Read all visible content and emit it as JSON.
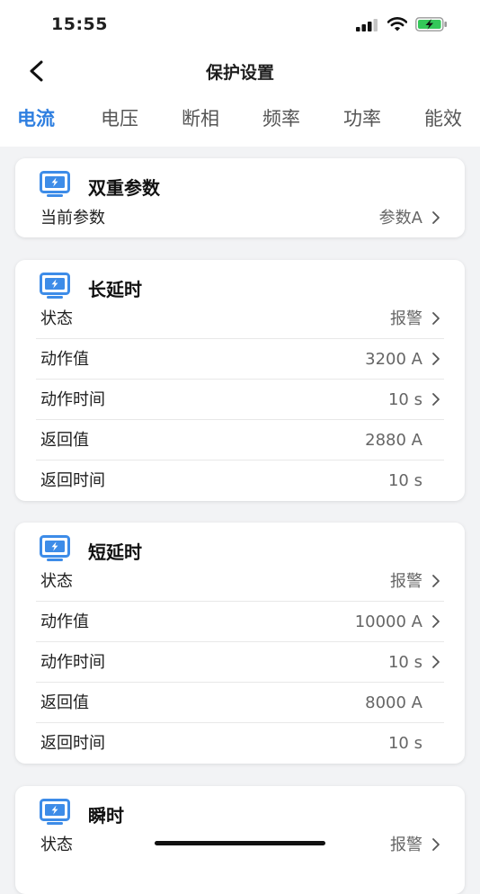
{
  "status_bar": {
    "time": "15:55",
    "icons": [
      "signal-icon",
      "wifi-icon",
      "battery-charging-icon"
    ]
  },
  "nav": {
    "title": "保护设置",
    "back_icon": "chevron-left-icon"
  },
  "tabs": [
    {
      "label": "电流",
      "active": true
    },
    {
      "label": "电压",
      "active": false
    },
    {
      "label": "断相",
      "active": false
    },
    {
      "label": "频率",
      "active": false
    },
    {
      "label": "功率",
      "active": false
    },
    {
      "label": "能效",
      "active": false
    }
  ],
  "colors": {
    "accent": "#2f7fe0",
    "card_icon": "#3d8ce8",
    "background": "#f2f3f5"
  },
  "cards": [
    {
      "title": "双重参数",
      "icon": "monitor-lightning-icon",
      "rows": [
        {
          "label": "当前参数",
          "value": "参数A",
          "has_arrow": true
        }
      ]
    },
    {
      "title": "长延时",
      "icon": "monitor-lightning-icon",
      "rows": [
        {
          "label": "状态",
          "value": "报警",
          "has_arrow": true
        },
        {
          "label": "动作值",
          "value": "3200 A",
          "has_arrow": true
        },
        {
          "label": "动作时间",
          "value": "10 s",
          "has_arrow": true
        },
        {
          "label": "返回值",
          "value": "2880 A",
          "has_arrow": false
        },
        {
          "label": "返回时间",
          "value": "10 s",
          "has_arrow": false
        }
      ]
    },
    {
      "title": "短延时",
      "icon": "monitor-lightning-icon",
      "rows": [
        {
          "label": "状态",
          "value": "报警",
          "has_arrow": true
        },
        {
          "label": "动作值",
          "value": "10000 A",
          "has_arrow": true
        },
        {
          "label": "动作时间",
          "value": "10 s",
          "has_arrow": true
        },
        {
          "label": "返回值",
          "value": "8000 A",
          "has_arrow": false
        },
        {
          "label": "返回时间",
          "value": "10 s",
          "has_arrow": false
        }
      ]
    },
    {
      "title": "瞬时",
      "icon": "monitor-lightning-icon",
      "rows": [
        {
          "label": "状态",
          "value": "报警",
          "has_arrow": true
        }
      ]
    }
  ]
}
